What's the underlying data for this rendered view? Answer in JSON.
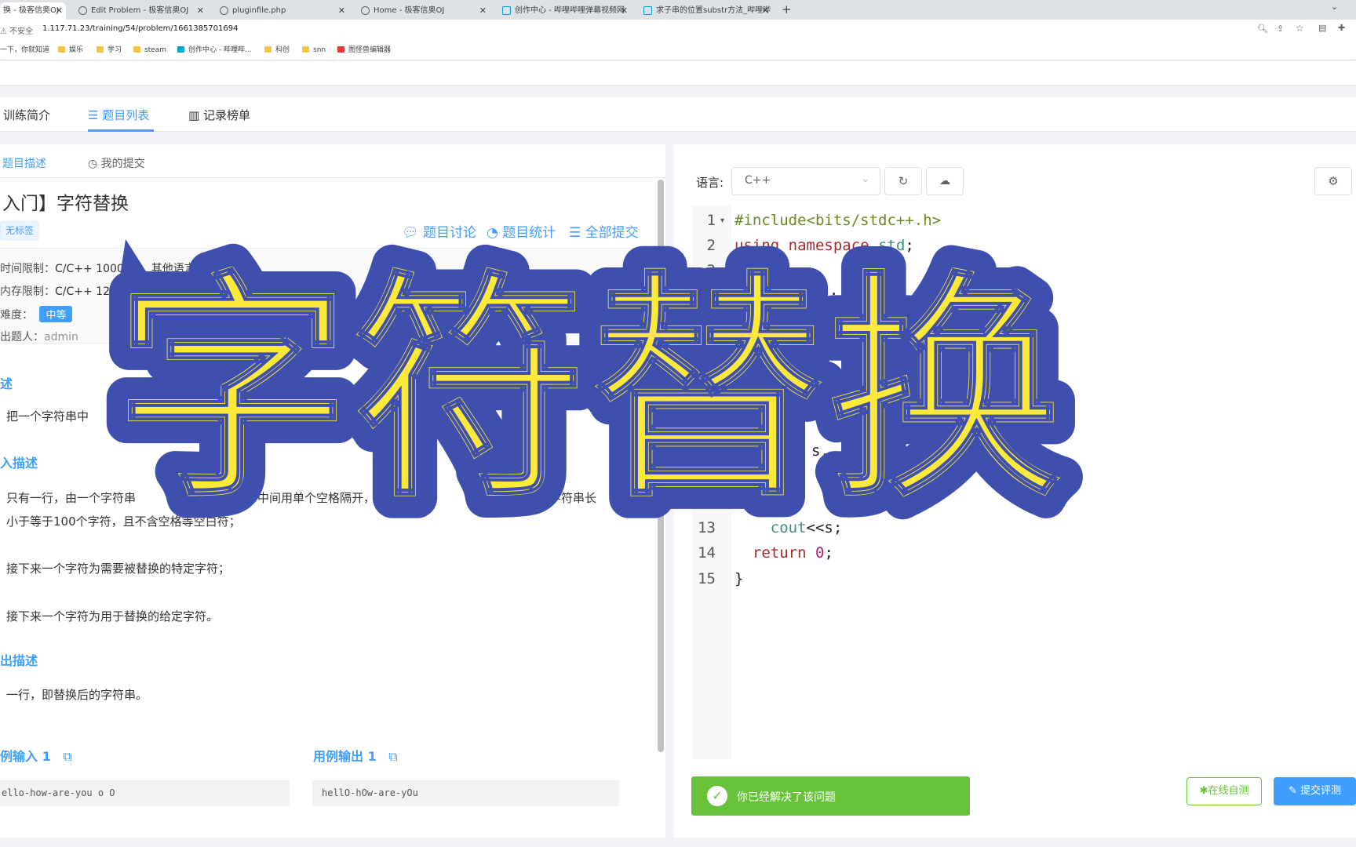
{
  "browser": {
    "tabs": [
      {
        "title": "换 - 极客信奥OJ",
        "active": true
      },
      {
        "title": "Edit Problem - 极客信奥OJ",
        "active": false
      },
      {
        "title": "pluginfile.php",
        "active": false
      },
      {
        "title": "Home - 极客信奥OJ",
        "active": false
      },
      {
        "title": "创作中心 - 哔哩哔哩弹幕视频网",
        "active": false
      },
      {
        "title": "求子串的位置substr方法_哔哩哔",
        "active": false
      }
    ],
    "security_label": "不安全",
    "url": "1.117.71.23/training/54/problem/1661385701694",
    "bookmarks": [
      "一下，你就知道",
      "娱乐",
      "学习",
      "steam",
      "创作中心 - 哔哩哔...",
      "科创",
      "snn",
      "图怪兽编辑器"
    ]
  },
  "subnav": {
    "tabs": [
      "训练简介",
      "题目列表",
      "记录榜单"
    ],
    "active": 1
  },
  "problem": {
    "tabs": [
      "题目描述",
      "我的提交"
    ],
    "title": "入门】字符替换",
    "tag": "无标签",
    "links": [
      "题目讨论",
      "题目统计",
      "全部提交"
    ],
    "time_limit_label": "时间限制：",
    "time_limit": "C/C++ 1000MS，其他语言 2000MS",
    "memory_limit_label": "内存限制：",
    "memory_limit": "C/C++ 128MB，其他",
    "difficulty_label": "难度：",
    "difficulty": "中等",
    "author_label": "出题人：",
    "author": "admin",
    "desc_heading": "述",
    "desc_text": "把一个字符串中",
    "input_heading": "入描述",
    "input_text_1": "只有一行，由一个字符串",
    "input_text_1b": "中间用单个空格隔开，字符串是待",
    "input_text_1c": "字符串长",
    "input_text_2": "小于等于100个字符，且不含空格等空白符；",
    "input_text_3": "接下来一个字符为需要被替换的特定字符；",
    "input_text_4": "接下来一个字符为用于替换的给定字符。",
    "output_heading": "出描述",
    "output_text": "一行，即替换后的字符串。",
    "sample_input_heading": "例输入 1",
    "sample_output_heading": "用例输出 1",
    "sample_input": "ello-how-are-you o O",
    "sample_output": "hellO-hOw-are-yOu"
  },
  "editor": {
    "lang_label": "语言:",
    "lang": "C++",
    "lines": [
      {
        "n": "1",
        "code": "#include<bits/stdc++.h>"
      },
      {
        "n": "2",
        "code": "using namespace std;"
      },
      {
        "n": "3",
        "code": ""
      },
      {
        "n": "13",
        "code": "    cout<<s;"
      },
      {
        "n": "14",
        "code": "  return 0;"
      },
      {
        "n": "15",
        "code": "}"
      }
    ],
    "partial_1": "();",
    "partial_2": "s",
    "partial_3": "s.",
    "solved_text": "你已经解决了该问题",
    "test_button": "在线自测",
    "submit_button": "提交评测"
  },
  "overlay_title": "字符替换",
  "colors": {
    "accent": "#409eff",
    "success": "#67c23a",
    "overlay_fill": "#fde93a",
    "overlay_stroke": "#3f4fae"
  }
}
